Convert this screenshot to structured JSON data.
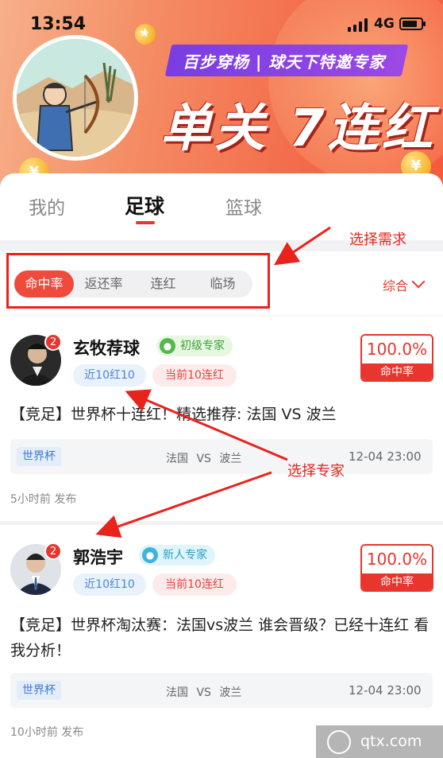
{
  "status_bar": {
    "time": "13:54",
    "network": "4G"
  },
  "banner": {
    "tagline": "百步穿杨 | 球天下特邀专家",
    "title": "单关 7连红",
    "coin_glyph": "¥"
  },
  "tabs": [
    {
      "label": "我的"
    },
    {
      "label": "足球",
      "active": true
    },
    {
      "label": "篮球"
    }
  ],
  "filters": {
    "segments": [
      "命中率",
      "返还率",
      "连红",
      "临场"
    ],
    "active": "命中率",
    "sort_label": "综合"
  },
  "annotations": {
    "choose_need": "选择需求",
    "choose_expert": "选择专家",
    "color": "#e8231c"
  },
  "experts": [
    {
      "badge": "2",
      "name": "玄牧荐球",
      "level": "初级专家",
      "tag_recent": "近10红10",
      "tag_current": "当前10连红",
      "rate_value": "100.0%",
      "rate_label": "命中率",
      "text": "【竞足】世界杯十连红！精选推荐: 法国 VS 波兰",
      "league": "世界杯",
      "teams": "法国 VS 波兰",
      "match_time": "12-04 23:00",
      "posted": "5小时前 发布"
    },
    {
      "badge": "2",
      "name": "郭浩宇",
      "level": "新人专家",
      "tag_recent": "近10红10",
      "tag_current": "当前10连红",
      "rate_value": "100.0%",
      "rate_label": "命中率",
      "text": "【竞足】世界杯淘汰赛：法国vs波兰  谁会晋级？已经十连红 看我分析！",
      "league": "世界杯",
      "teams": "法国 VS 波兰",
      "match_time": "12-04 23:00",
      "posted": "10小时前 发布"
    }
  ],
  "watermark": {
    "text": "qtx.com"
  },
  "colors": {
    "accent": "#e8352d",
    "purple": "#7a3de3"
  }
}
